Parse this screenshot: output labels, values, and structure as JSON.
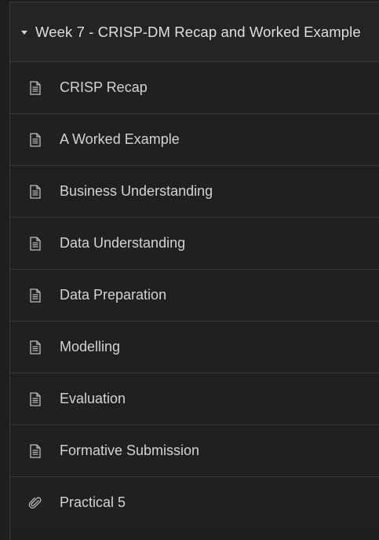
{
  "module": {
    "title": "Week 7 - CRISP-DM Recap and Worked Example",
    "expanded": true,
    "toggle_icon": "caret-down-icon"
  },
  "items": [
    {
      "label": "CRISP Recap",
      "icon": "document-icon"
    },
    {
      "label": "A Worked Example",
      "icon": "document-icon"
    },
    {
      "label": "Business Understanding",
      "icon": "document-icon"
    },
    {
      "label": "Data Understanding",
      "icon": "document-icon"
    },
    {
      "label": "Data Preparation",
      "icon": "document-icon"
    },
    {
      "label": "Modelling",
      "icon": "document-icon"
    },
    {
      "label": "Evaluation",
      "icon": "document-icon"
    },
    {
      "label": "Formative Submission",
      "icon": "document-icon"
    },
    {
      "label": "Practical 5",
      "icon": "paperclip-icon"
    }
  ],
  "colors": {
    "background": "#1f1f1f",
    "divider": "#3a3a3a",
    "text": "#d3d3d3",
    "icon": "#bdbdbd"
  }
}
